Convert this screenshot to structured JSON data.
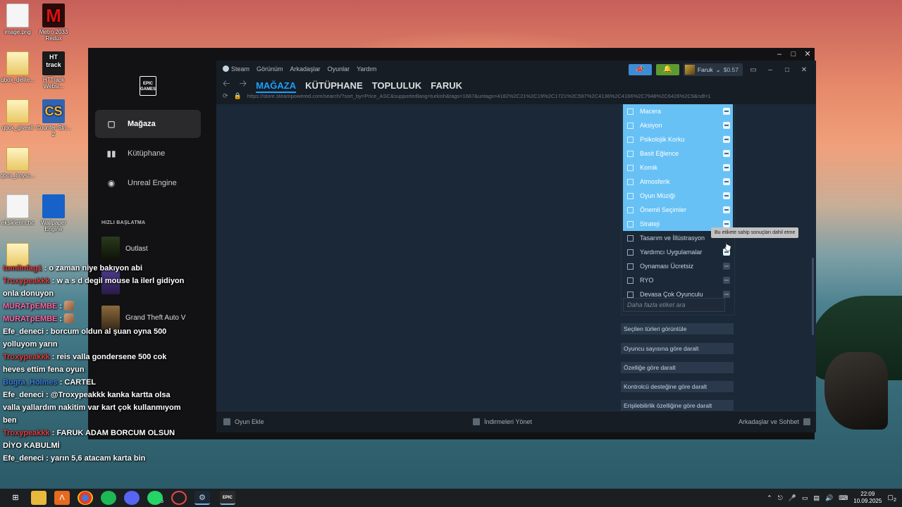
{
  "desktop": {
    "icons": [
      {
        "label": "image.png",
        "kind": "file"
      },
      {
        "label": "Metro 2033 Redux",
        "kind": "metro"
      },
      {
        "label": "qbox_delite...",
        "kind": "folder"
      },
      {
        "label": "HTTrack Websi...",
        "kind": "httrack"
      },
      {
        "label": "qbox_giveall",
        "kind": "folder"
      },
      {
        "label": "Counter-Stri... 2",
        "kind": "cs"
      },
      {
        "label": "qbox_boysc...",
        "kind": "folder"
      },
      {
        "label": "eksiklerim.txt",
        "kind": "file"
      },
      {
        "label": "Wallpaper Engine",
        "kind": "wallpaper"
      }
    ]
  },
  "epic": {
    "logo_text": "EPIC GAMES",
    "nav": [
      {
        "label": "Mağaza",
        "icon": "tag-icon",
        "active": true
      },
      {
        "label": "Kütüphane",
        "icon": "library-icon",
        "active": false
      },
      {
        "label": "Unreal Engine",
        "icon": "unreal-icon",
        "active": false
      }
    ],
    "quick_title": "HIZLI BAŞLATMA",
    "quick_items": [
      {
        "label": "Outlast"
      },
      {
        "label": ""
      },
      {
        "label": "Grand Theft Auto V"
      }
    ]
  },
  "steam": {
    "menu": [
      "Steam",
      "Görünüm",
      "Arkadaşlar",
      "Oyunlar",
      "Yardım"
    ],
    "user": {
      "name": "Faruk",
      "balance": "$0.57"
    },
    "tabs": [
      "MAĞAZA",
      "KÜTÜPHANE",
      "TOPLULUK",
      "FARUK"
    ],
    "active_tab": "MAĞAZA",
    "url": "https://store.steampowered.com/search/?sort_by=Price_ASC&supportedlang=turkish&tags=1667&untags=4182%2C21%2C19%2C1721%2C597%2C4136%2C4166%2C7948%2C6426%2C9&ndl=1",
    "tags": [
      {
        "label": "Macera",
        "excluded": true
      },
      {
        "label": "Aksiyon",
        "excluded": true
      },
      {
        "label": "Psikolojik Korku",
        "excluded": true
      },
      {
        "label": "Basit Eğlence",
        "excluded": true
      },
      {
        "label": "Komik",
        "excluded": true
      },
      {
        "label": "Atmosferik",
        "excluded": true
      },
      {
        "label": "Oyun Müziği",
        "excluded": true
      },
      {
        "label": "Önemli Seçimler",
        "excluded": true
      },
      {
        "label": "Strateji",
        "excluded": true
      },
      {
        "label": "Tasarım ve İllüstrasyon",
        "excluded": false
      },
      {
        "label": "Yardımcı Uygulamalar",
        "excluded": false
      },
      {
        "label": "Oynaması Ücretsiz",
        "excluded": false
      },
      {
        "label": "RYO",
        "excluded": false
      },
      {
        "label": "Devasa Çok Oyunculu",
        "excluded": false
      }
    ],
    "tag_search_placeholder": "Daha fazla etiket ara",
    "tooltip": "Bu etikete sahip sonuçları dahil etme",
    "filter_buttons": [
      "Seçilen türleri görüntüle",
      "Oyuncu sayısına göre daralt",
      "Özelliğe göre daralt",
      "Kontrolcü desteğine göre daralt",
      "Erişilebilirlik özelliğine göre daralt"
    ],
    "bottom": {
      "add_game": "Oyun Ekle",
      "downloads": "İndirmeleri Yönet",
      "friends": "Arkadaşlar ve Sohbet"
    },
    "accent": "#1a9fff",
    "selected_tag_color": "#67c1f5"
  },
  "chat": [
    {
      "user": "tomlinfag1",
      "color": "red",
      "text": ": o zaman niye bakıyon abi"
    },
    {
      "user": "Troxypeakkk",
      "color": "red",
      "text": ": w a s d degil mouse la ilerl gidiyon onla donuyon"
    },
    {
      "user": "MURATpEMBE",
      "color": "pink",
      "text": ":",
      "emote": true
    },
    {
      "user": "MURATpEMBE",
      "color": "pink",
      "text": ":",
      "emote": true
    },
    {
      "user": "Efe_deneci",
      "color": "white",
      "text": ": borcum oldun al şuan oyna 500 yolluyom yarın"
    },
    {
      "user": "Troxypeakkk",
      "color": "red",
      "text": ": reis valla gondersene 500 cok heves ettim fena oyun"
    },
    {
      "user": "Bugra_Holmes",
      "color": "blue",
      "text": ": CARTEL"
    },
    {
      "user": "Efe_deneci",
      "color": "white",
      "text": ": @Troxypeakkk kanka kartta olsa valla yallardım nakitim var kart çok kullanmıyom ben"
    },
    {
      "user": "Troxypeakkk",
      "color": "red",
      "text": ": FARUK ADAM BORCUM OLSUN DİYO KABULMİ"
    },
    {
      "user": "Efe_deneci",
      "color": "white",
      "text": ": yarın 5,6 atacam karta bin"
    }
  ],
  "taskbar": {
    "whatsapp_badge": "36",
    "time": "22:09",
    "date": "10.09.2025",
    "notif_count": "2"
  }
}
